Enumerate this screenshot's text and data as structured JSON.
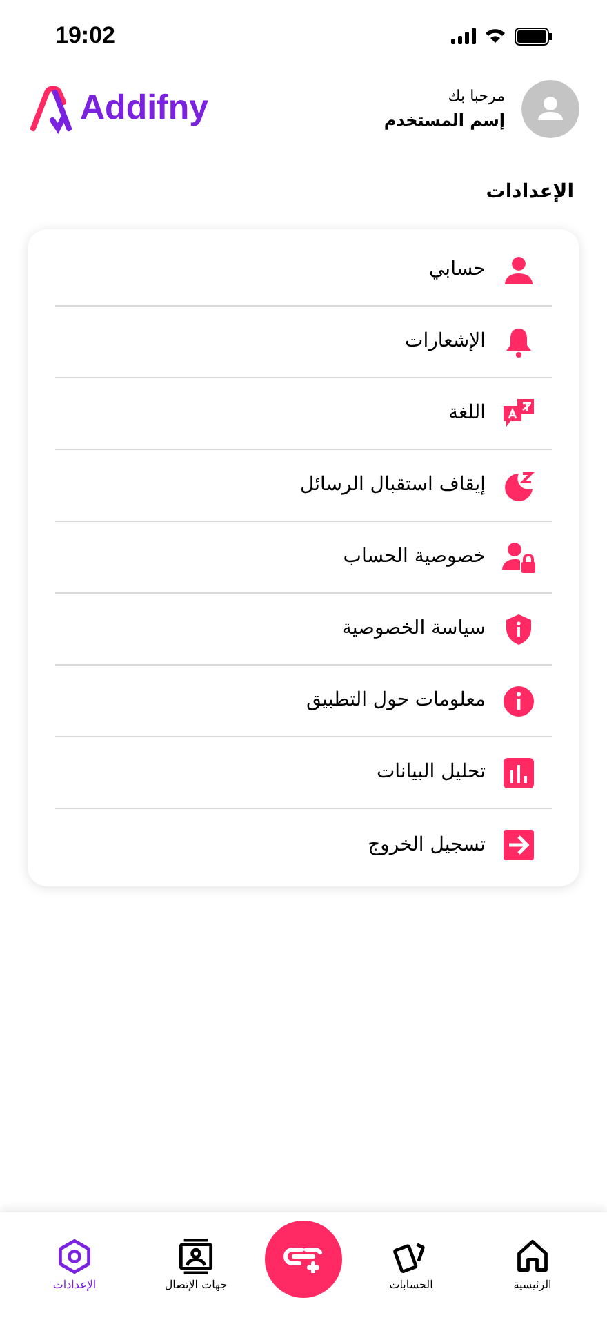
{
  "status_bar": {
    "time": "19:02"
  },
  "header": {
    "greeting": "مرحبا بك",
    "username": "إسم المستخدم",
    "logo": "Addifny"
  },
  "section_title": "الإعدادات",
  "settings": [
    {
      "label": "حسابي",
      "kind": "person"
    },
    {
      "label": "الإشعارات",
      "kind": "bell"
    },
    {
      "label": "اللغة",
      "kind": "language"
    },
    {
      "label": "إيقاف استقبال الرسائل",
      "kind": "sleep"
    },
    {
      "label": "خصوصية الحساب",
      "kind": "lock"
    },
    {
      "label": "سياسة الخصوصية",
      "kind": "shield"
    },
    {
      "label": "معلومات حول التطبيق",
      "kind": "info"
    },
    {
      "label": "تحليل البيانات",
      "kind": "chart"
    },
    {
      "label": "تسجيل الخروج",
      "kind": "logout"
    }
  ],
  "bottom_nav": [
    {
      "label": "الرئيسية",
      "kind": "home",
      "selected": false
    },
    {
      "label": "الحسابات",
      "kind": "cards",
      "selected": false
    },
    {
      "label": "جهات الإتصال",
      "kind": "contacts",
      "selected": false
    },
    {
      "label": "الإعدادات",
      "kind": "settings",
      "selected": true
    }
  ]
}
